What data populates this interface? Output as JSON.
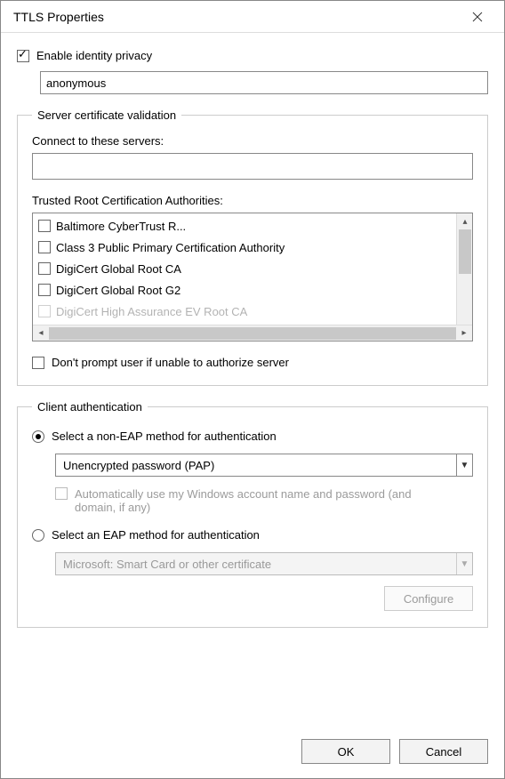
{
  "window": {
    "title": "TTLS Properties"
  },
  "identity": {
    "enable_label": "Enable identity privacy",
    "enable_checked": true,
    "value": "anonymous"
  },
  "cert_group": {
    "legend": "Server certificate validation",
    "connect_label": "Connect to these servers:",
    "connect_value": "",
    "ca_label": "Trusted Root Certification Authorities:",
    "ca_items": [
      {
        "label": "Baltimore CyberTrust R...",
        "checked": false
      },
      {
        "label": "Class 3 Public Primary Certification Authority",
        "checked": false
      },
      {
        "label": "DigiCert Global Root CA",
        "checked": false
      },
      {
        "label": "DigiCert Global Root G2",
        "checked": false
      },
      {
        "label": "DigiCert High Assurance EV Root CA",
        "checked": false
      }
    ],
    "dont_prompt_label": "Don't prompt user if unable to authorize server",
    "dont_prompt_checked": false
  },
  "client_group": {
    "legend": "Client authentication",
    "non_eap_label": "Select a non-EAP method for authentication",
    "non_eap_selected": true,
    "non_eap_value": "Unencrypted password (PAP)",
    "auto_windows_label": "Automatically use my Windows account name and password (and domain, if any)",
    "eap_label": "Select an EAP method for authentication",
    "eap_value": "Microsoft: Smart Card or other certificate",
    "configure_label": "Configure"
  },
  "buttons": {
    "ok": "OK",
    "cancel": "Cancel"
  }
}
